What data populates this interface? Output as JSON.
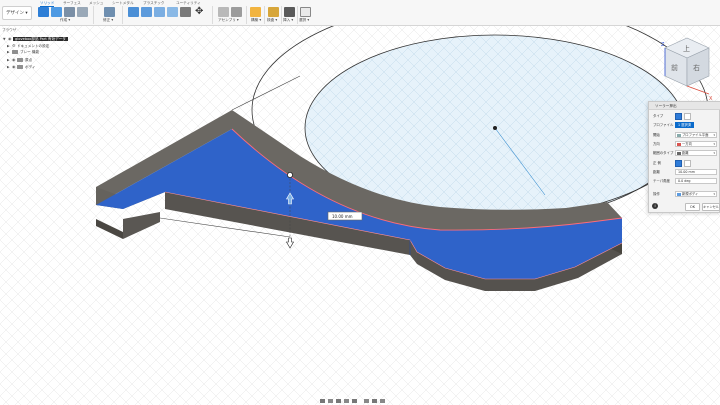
{
  "toolbar": {
    "design_label": "デザイン ▾",
    "tabs": [
      "ソリッド",
      "サーフェス",
      "メッシュ",
      "シートメタル",
      "プラスチック",
      "ユーティリティ"
    ],
    "groups": [
      "作成 ▾",
      "修正 ▾",
      "アセンブリ ▾",
      "構築 ▾",
      "検査 ▾",
      "挿入 ▾",
      "選択 ▾"
    ]
  },
  "browser": {
    "header": "ブラウザ",
    "items": [
      {
        "label": "glovebox部品 Part 有効データ"
      },
      {
        "label": "ドキュメントの設定"
      },
      {
        "label": "ブレー 機能"
      },
      {
        "label": "原点"
      },
      {
        "label": "ボディ"
      }
    ]
  },
  "viewcube": {
    "face_top": "上",
    "face_front": "前",
    "face_right": "右",
    "axis_z": "Z",
    "axis_x": "X"
  },
  "dimension_value": "10.00 mm",
  "dialog": {
    "title": "ソーラー押出",
    "rows": [
      {
        "label": "タイプ",
        "value": ""
      },
      {
        "label": "プロファイル",
        "value": "1 選択済"
      },
      {
        "label": "開始",
        "value": "プロファイル平面"
      },
      {
        "label": "方向",
        "value": "一方向"
      },
      {
        "label": "範囲のタイプ",
        "value": "距離"
      },
      {
        "label": "正 側",
        "value": ""
      },
      {
        "label": "距離",
        "value": "10.00 mm"
      },
      {
        "label": "テーパ角度",
        "value": "0.0 deg"
      },
      {
        "label": "操作",
        "value": "新規ボディ"
      }
    ],
    "ok": "OK",
    "cancel": "キャンセル"
  },
  "colors": {
    "accent": "#0b6bcb",
    "face": "#2f63c9",
    "solid": "#5a5753"
  }
}
